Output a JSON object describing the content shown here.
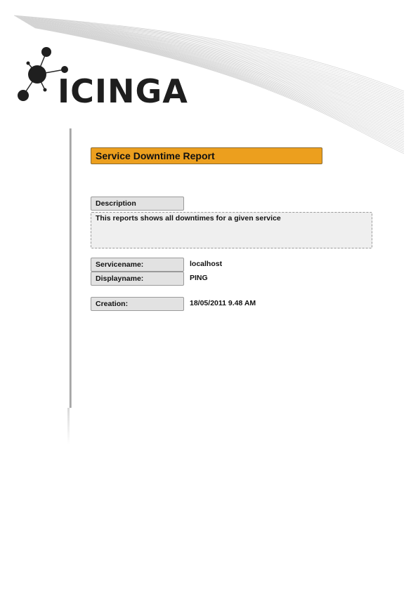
{
  "brand": {
    "wordmark": "ICINGA"
  },
  "report": {
    "title": "Service Downtime Report",
    "description_label": "Description",
    "description_text": "This reports shows all downtimes for a given service"
  },
  "fields": {
    "servicename_label": "Servicename:",
    "servicename_value": "localhost",
    "displayname_label": "Displayname:",
    "displayname_value": "PING",
    "creation_label": "Creation:",
    "creation_value": "18/05/2011 9.48 AM"
  },
  "colors": {
    "title_bar": "#ec9f1e",
    "label_fill": "#e2e2e2",
    "description_fill": "#efefef"
  }
}
